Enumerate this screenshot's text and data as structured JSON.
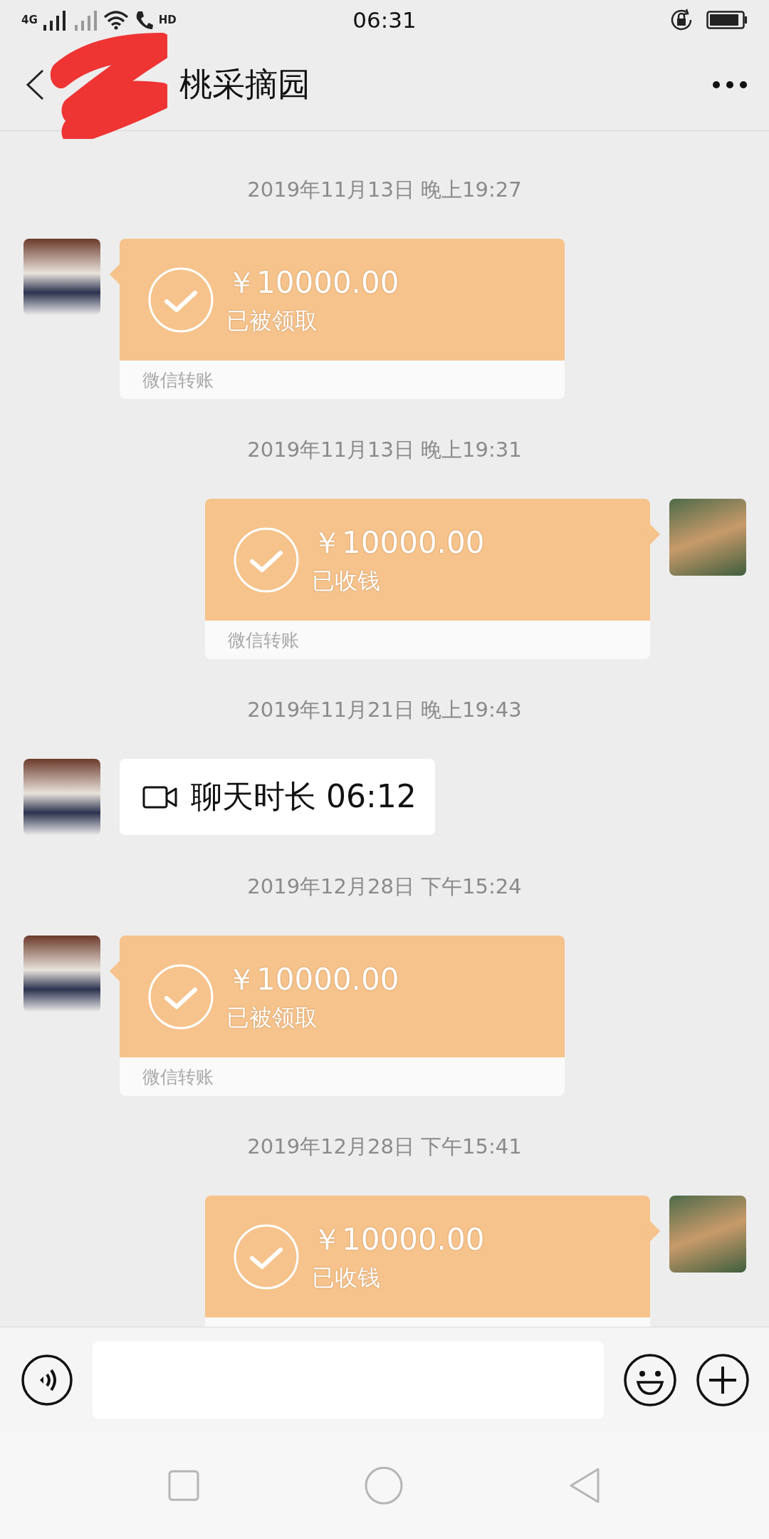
{
  "status_bar": {
    "network": "4G",
    "call_label": "HD",
    "time": "06:31"
  },
  "header": {
    "title": "桃采摘园"
  },
  "messages": [
    {
      "kind": "timestamp",
      "text": "2019年11月13日 晚上19:27"
    },
    {
      "kind": "transfer",
      "outgoing": false,
      "amount": "￥10000.00",
      "status": "已被领取",
      "footer": "微信转账"
    },
    {
      "kind": "timestamp",
      "text": "2019年11月13日 晚上19:31"
    },
    {
      "kind": "transfer",
      "outgoing": true,
      "amount": "￥10000.00",
      "status": "已收钱",
      "footer": "微信转账"
    },
    {
      "kind": "timestamp",
      "text": "2019年11月21日 晚上19:43"
    },
    {
      "kind": "call",
      "outgoing": false,
      "text": "聊天时长 06:12"
    },
    {
      "kind": "timestamp",
      "text": "2019年12月28日 下午15:24"
    },
    {
      "kind": "transfer",
      "outgoing": false,
      "amount": "￥10000.00",
      "status": "已被领取",
      "footer": "微信转账"
    },
    {
      "kind": "timestamp",
      "text": "2019年12月28日 下午15:41"
    },
    {
      "kind": "transfer",
      "outgoing": true,
      "amount": "￥10000.00",
      "status": "已收钱"
    }
  ]
}
